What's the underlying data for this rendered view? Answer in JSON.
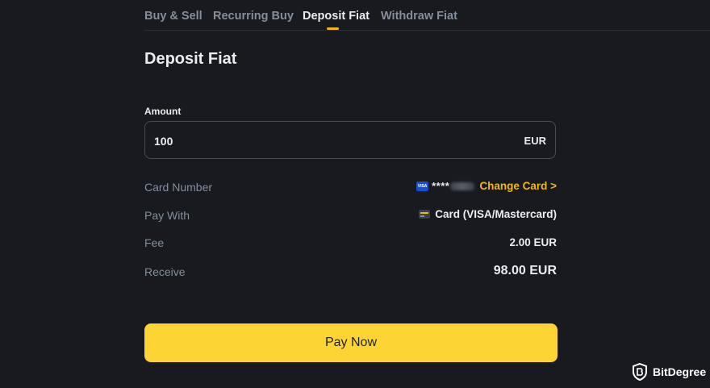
{
  "tabs": [
    {
      "label": "Buy & Sell",
      "active": false
    },
    {
      "label": "Recurring Buy",
      "active": false
    },
    {
      "label": "Deposit Fiat",
      "active": true
    },
    {
      "label": "Withdraw Fiat",
      "active": false
    }
  ],
  "page_title": "Deposit Fiat",
  "amount": {
    "label": "Amount",
    "value": "100",
    "currency": "EUR"
  },
  "card_number": {
    "label": "Card Number",
    "card_brand": "VISA",
    "masked": "****",
    "change_label": "Change Card >"
  },
  "pay_with": {
    "label": "Pay With",
    "value": "Card (VISA/Mastercard)"
  },
  "fee": {
    "label": "Fee",
    "value": "2.00 EUR"
  },
  "receive": {
    "label": "Receive",
    "value": "98.00 EUR"
  },
  "pay_button_label": "Pay Now",
  "watermark": "BitDegree",
  "colors": {
    "background": "#181a20",
    "accent": "#f0b90b",
    "button": "#fcd535",
    "muted_text": "#848e9c"
  }
}
